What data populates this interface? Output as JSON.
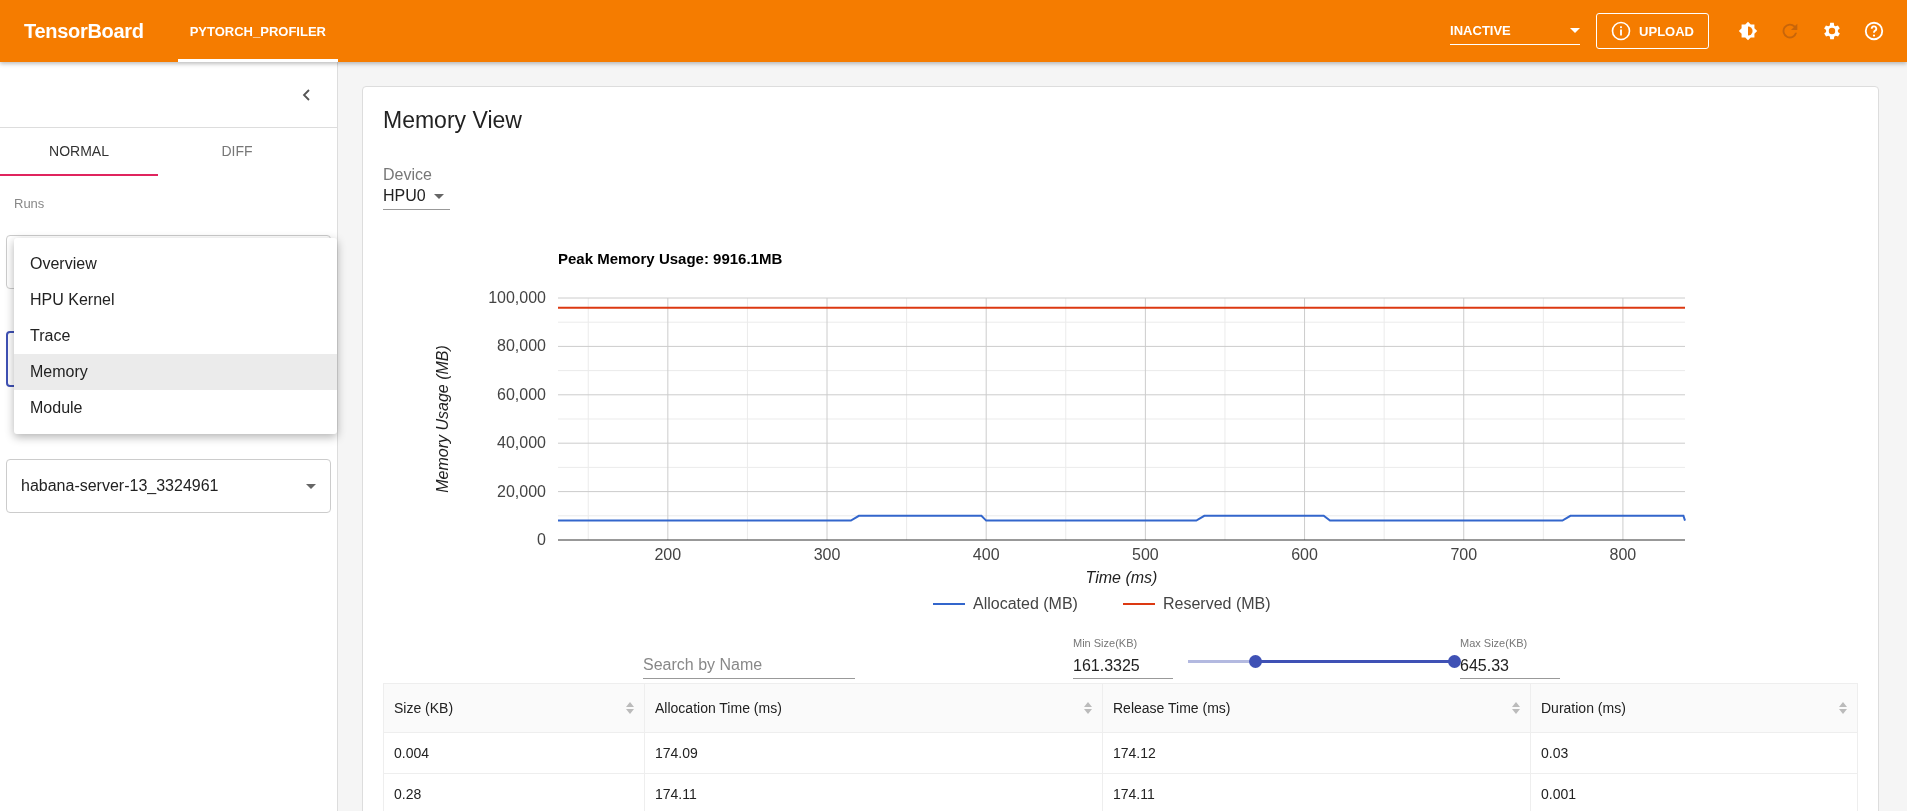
{
  "app_bar": {
    "title": "TensorBoard",
    "tabs": [
      {
        "label": "PYTORCH_PROFILER",
        "selected": true
      }
    ],
    "status_select": {
      "value": "INACTIVE"
    },
    "upload_button": "UPLOAD",
    "tools": [
      {
        "kind": "theme",
        "disabled": false
      },
      {
        "kind": "refresh",
        "disabled": true
      },
      {
        "kind": "settings",
        "disabled": false
      },
      {
        "kind": "help",
        "disabled": false
      }
    ]
  },
  "sidebar": {
    "tabs": [
      {
        "label": "NORMAL",
        "selected": true
      },
      {
        "label": "DIFF",
        "selected": false
      }
    ],
    "runs_label": "Runs",
    "workers_select": {
      "value": "habana-server-13_3324961"
    },
    "views_menu": [
      {
        "label": "Overview",
        "selected": false
      },
      {
        "label": "HPU Kernel",
        "selected": false
      },
      {
        "label": "Trace",
        "selected": false
      },
      {
        "label": "Memory",
        "selected": true
      },
      {
        "label": "Module",
        "selected": false
      }
    ]
  },
  "main": {
    "title": "Memory View",
    "device": {
      "label": "Device",
      "value": "HPU0"
    },
    "chart_data": {
      "type": "line",
      "title": "Peak Memory Usage: 9916.1MB",
      "xlabel": "Time (ms)",
      "ylabel": "Memory Usage (MB)",
      "x": [
        131,
        315,
        320,
        397,
        400,
        532,
        537,
        612,
        616,
        762,
        767,
        838,
        839
      ],
      "series": [
        {
          "name": "Allocated (MB)",
          "color": "#3366cc",
          "values": [
            8000,
            8000,
            10000,
            10000,
            8000,
            8000,
            10000,
            10000,
            8000,
            8000,
            10000,
            10000,
            8000
          ]
        },
        {
          "name": "Reserved (MB)",
          "color": "#dc3912",
          "values": [
            96000,
            96000,
            96000,
            96000,
            96000,
            96000,
            96000,
            96000,
            96000,
            96000,
            96000,
            96000,
            96000
          ]
        }
      ],
      "grid": true,
      "legend": "bottom",
      "xlim": [
        131,
        839
      ],
      "ylim": [
        0,
        100000
      ],
      "xticks": [
        200,
        300,
        400,
        500,
        600,
        700,
        800
      ],
      "yticks": [
        {
          "value": 0,
          "label": "0"
        },
        {
          "value": 20000,
          "label": "20,000"
        },
        {
          "value": 40000,
          "label": "40,000"
        },
        {
          "value": 60000,
          "label": "60,000"
        },
        {
          "value": 80000,
          "label": "80,000"
        },
        {
          "value": 100000,
          "label": "100,000"
        }
      ]
    },
    "search": {
      "placeholder": "Search by Name"
    },
    "min_size": {
      "label": "Min Size(KB)",
      "value": "161.3325"
    },
    "max_size": {
      "label": "Max Size(KB)",
      "value": "645.33"
    },
    "size_slider": [
      {
        "level": 0.25
      },
      {
        "level": 1
      }
    ],
    "table": {
      "columns": [
        "Size (KB)",
        "Allocation Time (ms)",
        "Release Time (ms)",
        "Duration (ms)"
      ],
      "rows": [
        [
          "0.004",
          "174.09",
          "174.12",
          "0.03"
        ],
        [
          "0.28",
          "174.11",
          "174.11",
          "0.001"
        ]
      ]
    }
  }
}
